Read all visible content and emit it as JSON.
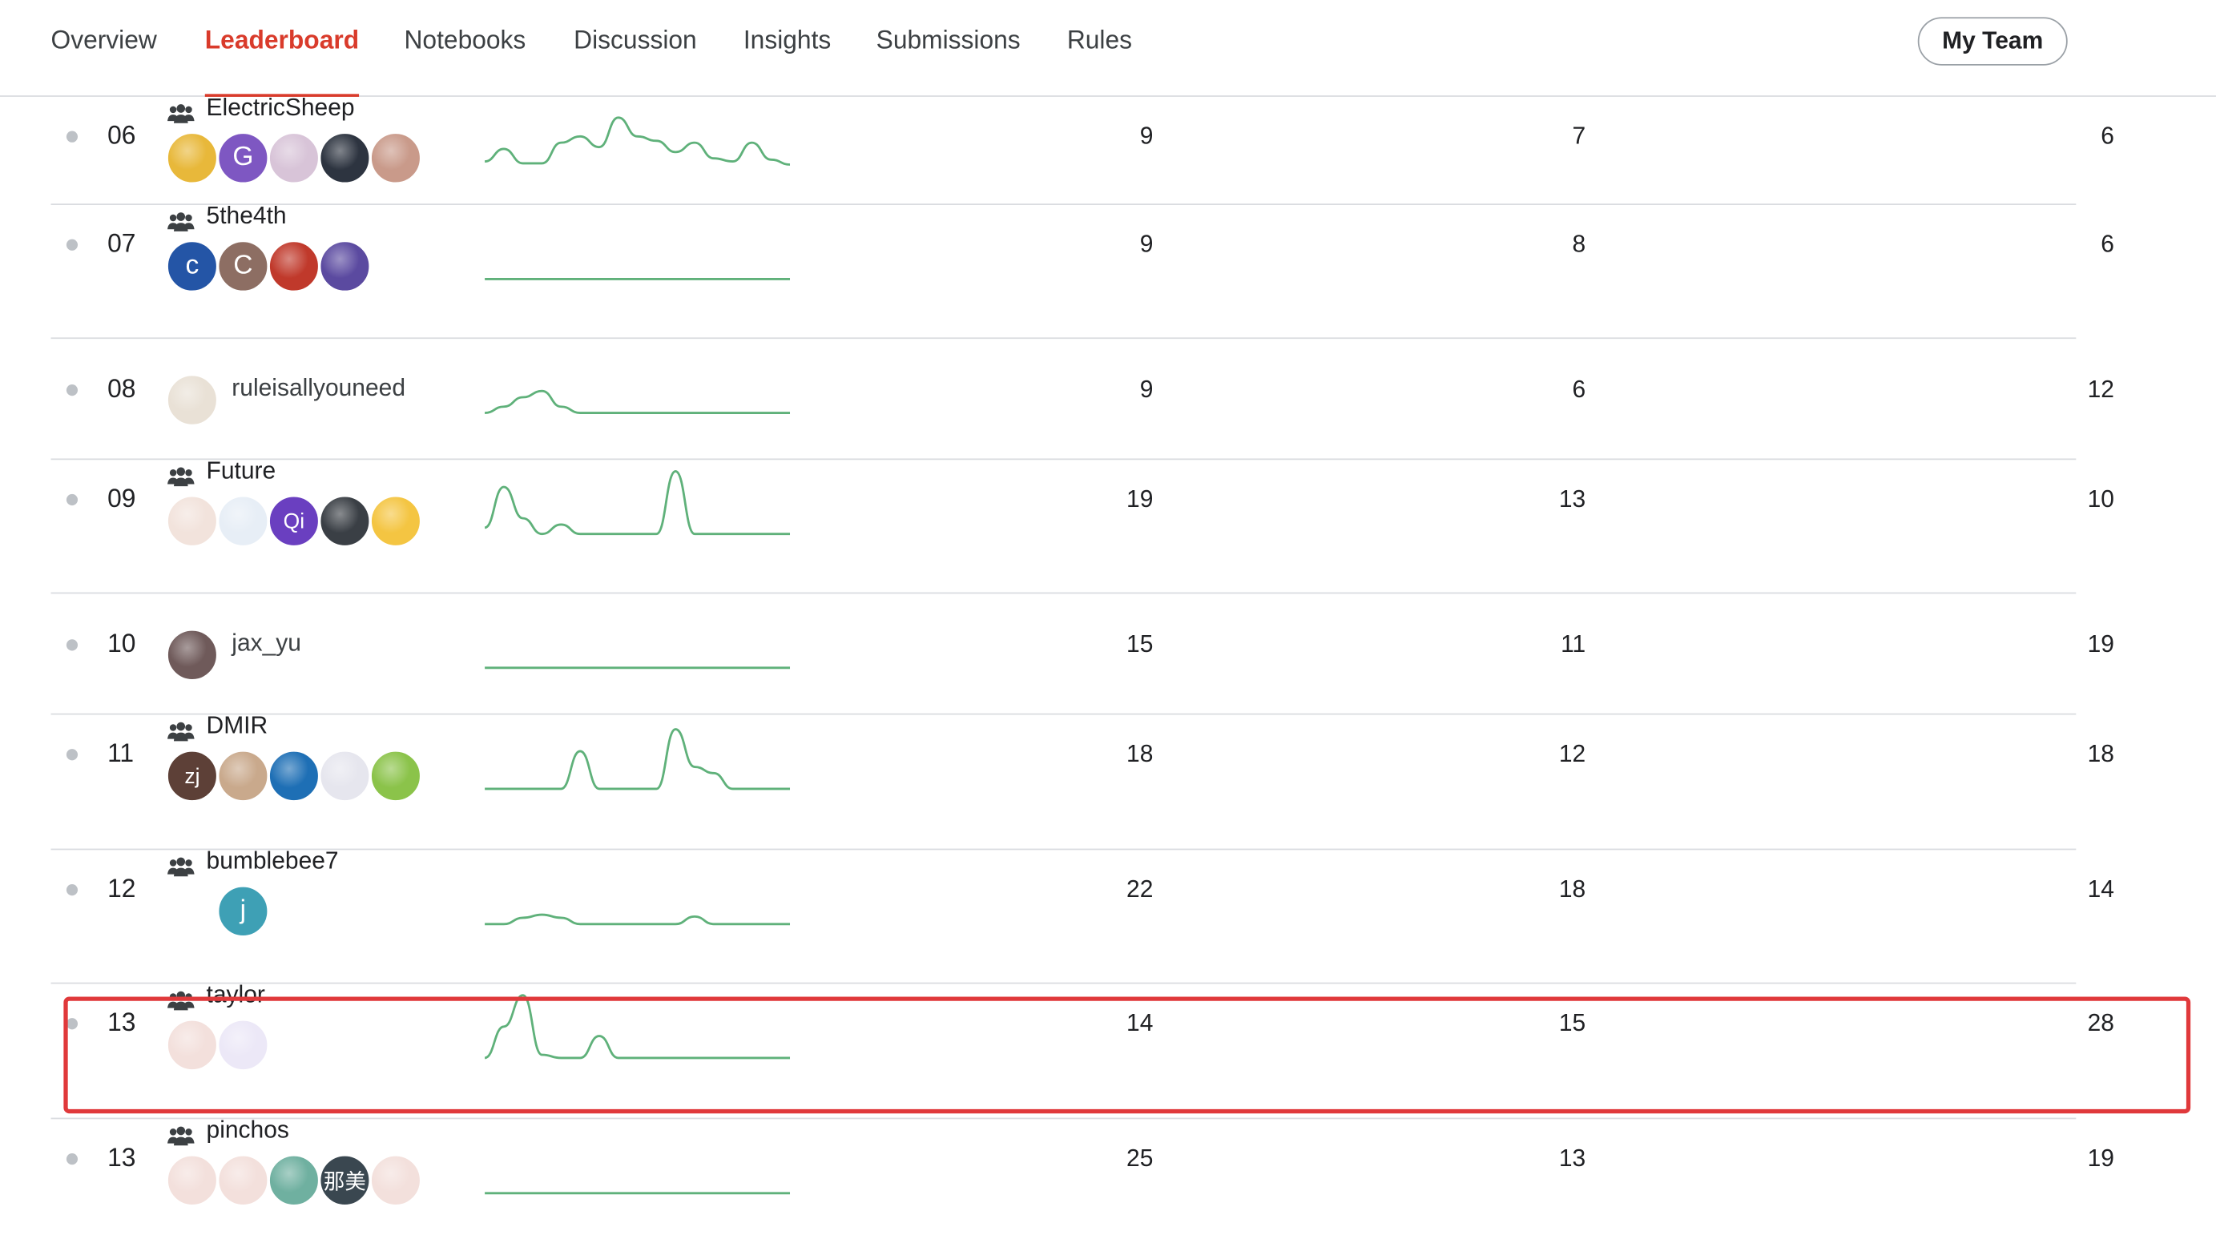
{
  "tabs": [
    {
      "label": "Overview",
      "active": false
    },
    {
      "label": "Leaderboard",
      "active": true
    },
    {
      "label": "Notebooks",
      "active": false
    },
    {
      "label": "Discussion",
      "active": false
    },
    {
      "label": "Insights",
      "active": false
    },
    {
      "label": "Submissions",
      "active": false
    },
    {
      "label": "Rules",
      "active": false
    }
  ],
  "my_team_label": "My Team",
  "accent_color": "#d93b2b",
  "spark_color": "#5fb17a",
  "highlight_color": "#e0393b",
  "rows": [
    {
      "rank": "06",
      "name": "ElectricSheep",
      "is_team": true,
      "avatars": [
        {
          "kind": "image",
          "color": "#e8b83a"
        },
        {
          "kind": "letter",
          "letter": "G",
          "color": "#7e57c2"
        },
        {
          "kind": "image",
          "color": "#d8c4d8"
        },
        {
          "kind": "image",
          "color": "#2d3440"
        },
        {
          "kind": "image",
          "color": "#c99a8a"
        }
      ],
      "spark": [
        0.15,
        0.35,
        0.12,
        0.12,
        0.45,
        0.55,
        0.38,
        0.85,
        0.55,
        0.48,
        0.3,
        0.45,
        0.2,
        0.15,
        0.45,
        0.18,
        0.1
      ],
      "col1": "9",
      "col2": "7",
      "col3": "6"
    },
    {
      "rank": "07",
      "name": "5the4th",
      "is_team": true,
      "avatars": [
        {
          "kind": "letter",
          "letter": "c",
          "color": "#2455a6"
        },
        {
          "kind": "letter",
          "letter": "C",
          "color": "#8d6e63"
        },
        {
          "kind": "image",
          "color": "#c0392b"
        },
        {
          "kind": "image",
          "color": "#5b4aa0"
        }
      ],
      "spark": [
        0,
        0,
        0,
        0,
        0,
        0,
        0,
        0,
        0,
        0,
        0,
        0,
        0,
        0,
        0,
        0,
        0
      ],
      "col1": "9",
      "col2": "8",
      "col3": "6"
    },
    {
      "rank": "08",
      "name": "ruleisallyouneed",
      "is_team": false,
      "avatars": [
        {
          "kind": "image",
          "color": "#e9e1d6"
        }
      ],
      "spark": [
        0,
        0.1,
        0.25,
        0.35,
        0.1,
        0,
        0,
        0,
        0,
        0,
        0,
        0,
        0,
        0,
        0,
        0,
        0
      ],
      "col1": "9",
      "col2": "6",
      "col3": "12"
    },
    {
      "rank": "09",
      "name": "Future",
      "is_team": true,
      "avatars": [
        {
          "kind": "image",
          "color": "#f2e3dc"
        },
        {
          "kind": "image",
          "color": "#e7eef6"
        },
        {
          "kind": "letter",
          "letter": "Qi",
          "color": "#6a3fc0"
        },
        {
          "kind": "image",
          "color": "#3a3f45"
        },
        {
          "kind": "image",
          "color": "#f4c542"
        }
      ],
      "spark": [
        0.1,
        0.75,
        0.25,
        0.0,
        0.15,
        0.0,
        0.0,
        0.0,
        0.0,
        0.0,
        1.0,
        0.0,
        0.0,
        0.0,
        0.0,
        0.0,
        0.0
      ],
      "col1": "19",
      "col2": "13",
      "col3": "10"
    },
    {
      "rank": "10",
      "name": "jax_yu",
      "is_team": false,
      "avatars": [
        {
          "kind": "image",
          "color": "#6f5a5a"
        }
      ],
      "spark": [
        0,
        0,
        0,
        0,
        0,
        0,
        0,
        0,
        0,
        0,
        0,
        0,
        0,
        0,
        0,
        0,
        0
      ],
      "col1": "15",
      "col2": "11",
      "col3": "19"
    },
    {
      "rank": "11",
      "name": "DMIR",
      "is_team": true,
      "avatars": [
        {
          "kind": "letter",
          "letter": "zj",
          "color": "#5d4037"
        },
        {
          "kind": "image",
          "color": "#c9a98c"
        },
        {
          "kind": "image",
          "color": "#1e6fb5"
        },
        {
          "kind": "image",
          "color": "#e6e6ee"
        },
        {
          "kind": "image",
          "color": "#8bc34a"
        }
      ],
      "spark": [
        0,
        0,
        0,
        0,
        0,
        0.6,
        0,
        0,
        0,
        0,
        0.95,
        0.35,
        0.25,
        0,
        0,
        0,
        0
      ],
      "col1": "18",
      "col2": "12",
      "col3": "18"
    },
    {
      "rank": "12",
      "name": "bumblebee7",
      "is_team": true,
      "avatars": [
        {
          "kind": "spacer"
        },
        {
          "kind": "letter",
          "letter": "j",
          "color": "#3ea0b5"
        }
      ],
      "spark": [
        0,
        0,
        0.1,
        0.15,
        0.1,
        0,
        0,
        0,
        0,
        0,
        0,
        0.12,
        0,
        0,
        0,
        0,
        0
      ],
      "col1": "22",
      "col2": "18",
      "col3": "14"
    },
    {
      "rank": "13",
      "name": "taylor",
      "is_team": true,
      "avatars": [
        {
          "kind": "image",
          "color": "#f3e0dc"
        },
        {
          "kind": "image",
          "color": "#ece8f7"
        }
      ],
      "spark": [
        0,
        0.5,
        1.0,
        0.05,
        0,
        0,
        0.35,
        0,
        0,
        0,
        0,
        0,
        0,
        0,
        0,
        0,
        0
      ],
      "col1": "14",
      "col2": "15",
      "col3": "28"
    },
    {
      "rank": "13",
      "name": "pinchos",
      "is_team": true,
      "avatars": [
        {
          "kind": "image",
          "color": "#f3e0dc"
        },
        {
          "kind": "image",
          "color": "#f3e0dc"
        },
        {
          "kind": "image",
          "color": "#6fb0a0"
        },
        {
          "kind": "letter",
          "letter": "那美",
          "color": "#3a4750"
        },
        {
          "kind": "image",
          "color": "#f3e0dc"
        }
      ],
      "spark": [
        0,
        0,
        0,
        0,
        0,
        0,
        0,
        0,
        0,
        0,
        0,
        0,
        0,
        0,
        0,
        0,
        0
      ],
      "col1": "25",
      "col2": "13",
      "col3": "19"
    }
  ]
}
